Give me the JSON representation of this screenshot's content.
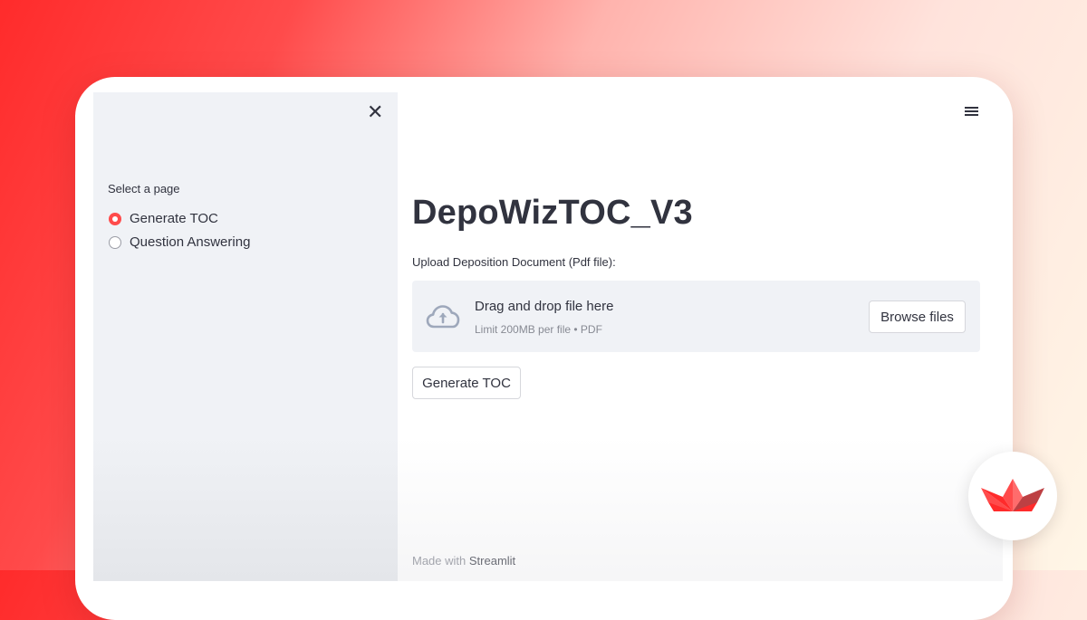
{
  "sidebar": {
    "radio_label": "Select a page",
    "options": [
      {
        "label": "Generate TOC",
        "selected": true
      },
      {
        "label": "Question Answering",
        "selected": false
      }
    ]
  },
  "main": {
    "title": "DepoWizTOC_V3",
    "upload_label": "Upload Deposition Document (Pdf file):",
    "dropzone": {
      "title": "Drag and drop file here",
      "subtitle": "Limit 200MB per file • PDF",
      "browse_label": "Browse files"
    },
    "generate_label": "Generate TOC"
  },
  "footer": {
    "made_with": "Made with",
    "brand": "Streamlit"
  },
  "colors": {
    "accent": "#ff4b4b",
    "text": "#31333f",
    "sidebar_bg": "#f0f2f6"
  },
  "icons": [
    "close-icon",
    "hamburger-menu-icon",
    "cloud-upload-icon",
    "streamlit-logo-icon"
  ]
}
